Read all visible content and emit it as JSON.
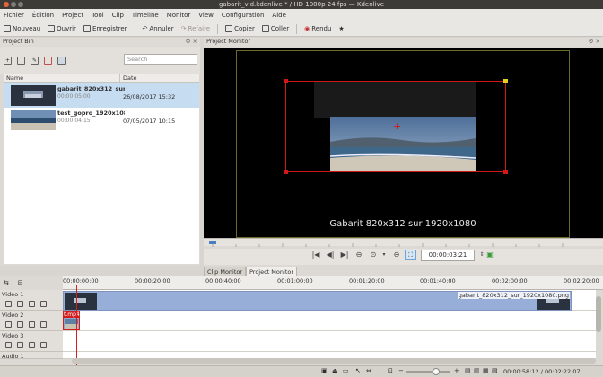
{
  "window": {
    "title": "gabarit_vid.kdenlive * / HD 1080p 24 fps — Kdenlive"
  },
  "menu": [
    "Fichier",
    "Édition",
    "Project",
    "Tool",
    "Clip",
    "Timeline",
    "Monitor",
    "View",
    "Configuration",
    "Aide"
  ],
  "toolbar": {
    "nouveau": "Nouveau",
    "ouvrir": "Ouvrir",
    "enregistrer": "Enregistrer",
    "annuler": "Annuler",
    "refaire": "Refaire",
    "copier": "Copier",
    "coller": "Coller",
    "rendu": "Rendu"
  },
  "bin": {
    "title": "Project Bin",
    "search_placeholder": "Search",
    "col_name": "Name",
    "col_date": "Date",
    "items": [
      {
        "name": "gabarit_820x312_sur_",
        "duration": "00:00:05:00",
        "date": "26/08/2017 15:32"
      },
      {
        "name": "test_gopro_1920x108",
        "duration": "00:00:04:15",
        "date": "07/05/2017 10:15"
      }
    ]
  },
  "monitor": {
    "title": "Project Monitor",
    "overlay_text": "Gabarit 820x312 sur 1920x1080",
    "timecode": "00:00:03:21"
  },
  "tabs": {
    "clip": "Clip Monitor",
    "project": "Project Monitor"
  },
  "timeline": {
    "ticks": [
      "00:00:00:00",
      "00:00:20:00",
      "00:00:40:00",
      "00:01:00:00",
      "00:01:20:00",
      "00:01:40:00",
      "00:02:00:00",
      "00:02:20:00"
    ],
    "tracks": [
      "Video 1",
      "Video 2",
      "Video 3",
      "Audio 1"
    ],
    "clip1": "gabarit_820x312_sur_1920x1080.png",
    "clip2": "t.mp4"
  },
  "status": {
    "position": "00:00:58:12",
    "duration": "00:02:22:07"
  },
  "colors": {
    "accent": "#d31c1c",
    "selection": "#c5dcf1",
    "clip": "#97aed8"
  }
}
